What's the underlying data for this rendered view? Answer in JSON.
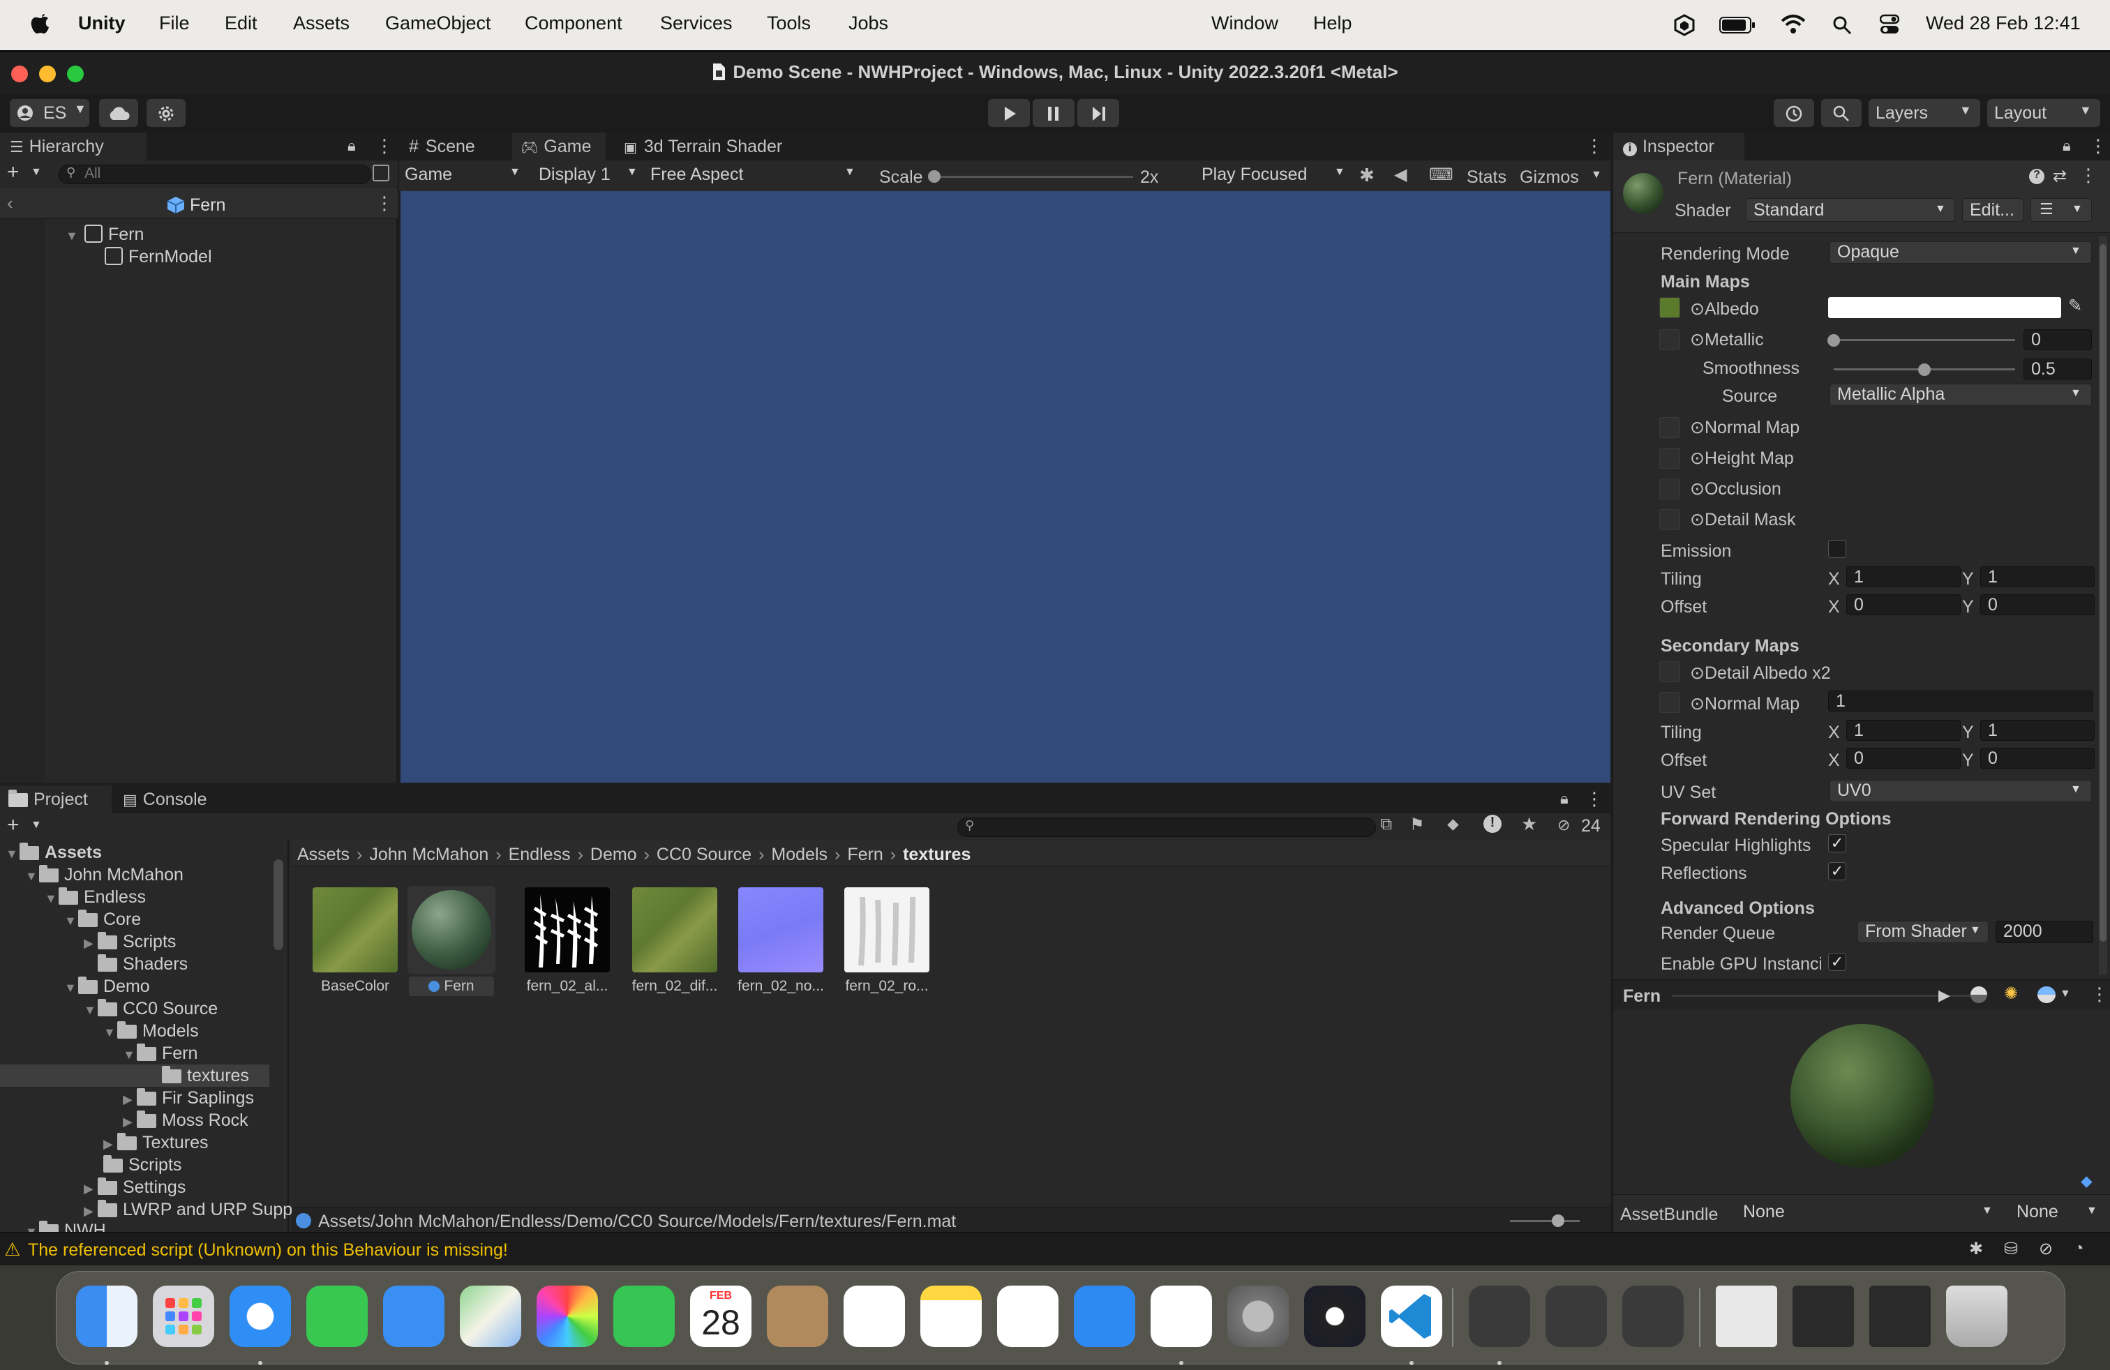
{
  "menubar": {
    "app": "Unity",
    "items": [
      "File",
      "Edit",
      "Assets",
      "GameObject",
      "Component",
      "Services",
      "Tools",
      "Jobs",
      "Window",
      "Help"
    ],
    "datetime": "Wed 28 Feb  12:41"
  },
  "window": {
    "title": "Demo Scene - NWHProject - Windows, Mac, Linux - Unity 2022.3.20f1 <Metal>"
  },
  "toolbar": {
    "account": "ES",
    "layers": "Layers",
    "layout": "Layout"
  },
  "hierarchy": {
    "tab": "Hierarchy",
    "search_placeholder": "All",
    "scene": "Fern",
    "items": [
      "Fern",
      "FernModel"
    ]
  },
  "game": {
    "tabs": [
      "Scene",
      "Game",
      "3d Terrain Shader"
    ],
    "view": "Game",
    "display": "Display 1",
    "aspect": "Free Aspect",
    "scale_label": "Scale",
    "scale_value": "2x",
    "play_mode": "Play Focused",
    "stats": "Stats",
    "gizmos": "Gizmos"
  },
  "project": {
    "tabs": [
      "Project",
      "Console"
    ],
    "hidden_count": "24",
    "breadcrumb": [
      "Assets",
      "John McMahon",
      "Endless",
      "Demo",
      "CC0 Source",
      "Models",
      "Fern",
      "textures"
    ],
    "tree": {
      "assets": "Assets",
      "john": "John McMahon",
      "endless": "Endless",
      "core": "Core",
      "scripts": "Scripts",
      "shaders": "Shaders",
      "demo": "Demo",
      "cc0": "CC0 Source",
      "models": "Models",
      "fern": "Fern",
      "textures": "textures",
      "fir": "Fir Saplings",
      "moss": "Moss Rock",
      "textures2": "Textures",
      "scripts2": "Scripts",
      "settings": "Settings",
      "lwrp": "LWRP and URP Supp",
      "nwh": "NWH"
    },
    "assets": [
      "BaseColor",
      "Fern",
      "fern_02_al...",
      "fern_02_dif...",
      "fern_02_no...",
      "fern_02_ro..."
    ],
    "path": "Assets/John McMahon/Endless/Demo/CC0 Source/Models/Fern/textures/Fern.mat"
  },
  "inspector": {
    "tab": "Inspector",
    "material": "Fern (Material)",
    "shader_label": "Shader",
    "shader": "Standard",
    "edit": "Edit...",
    "rendering_mode_label": "Rendering Mode",
    "rendering_mode": "Opaque",
    "main_maps": "Main Maps",
    "albedo": "Albedo",
    "metallic": "Metallic",
    "metallic_value": "0",
    "metallic_level": 0,
    "smoothness": "Smoothness",
    "smoothness_value": "0.5",
    "smoothness_level": 0.5,
    "source_label": "Source",
    "source": "Metallic Alpha",
    "normal_map": "Normal Map",
    "height_map": "Height Map",
    "occlusion": "Occlusion",
    "detail_mask": "Detail Mask",
    "emission": "Emission",
    "tiling": "Tiling",
    "offset": "Offset",
    "x": "X",
    "y": "Y",
    "main_tiling": [
      "1",
      "1"
    ],
    "main_offset": [
      "0",
      "0"
    ],
    "secondary_maps": "Secondary Maps",
    "detail_albedo": "Detail Albedo x2",
    "sec_normal": "Normal Map",
    "sec_normal_value": "1",
    "sec_tiling": [
      "1",
      "1"
    ],
    "sec_offset": [
      "0",
      "0"
    ],
    "uv_set_label": "UV Set",
    "uv_set": "UV0",
    "forward": "Forward Rendering Options",
    "specular": "Specular Highlights",
    "reflections": "Reflections",
    "advanced": "Advanced Options",
    "render_queue": "Render Queue",
    "render_queue_mode": "From Shader",
    "render_queue_value": "2000",
    "gpu_instancing": "Enable GPU Instancir",
    "preview_name": "Fern",
    "assetbundle_label": "AssetBundle",
    "assetbundle": "None",
    "variant": "None"
  },
  "status": {
    "message": "The referenced script (Unknown) on this Behaviour is missing!"
  },
  "dock": {
    "calendar_month": "FEB",
    "calendar_day": "28"
  },
  "colors": {
    "viewport": "#324a7a",
    "accent": "#3a79d8",
    "warning": "#f0c000"
  }
}
